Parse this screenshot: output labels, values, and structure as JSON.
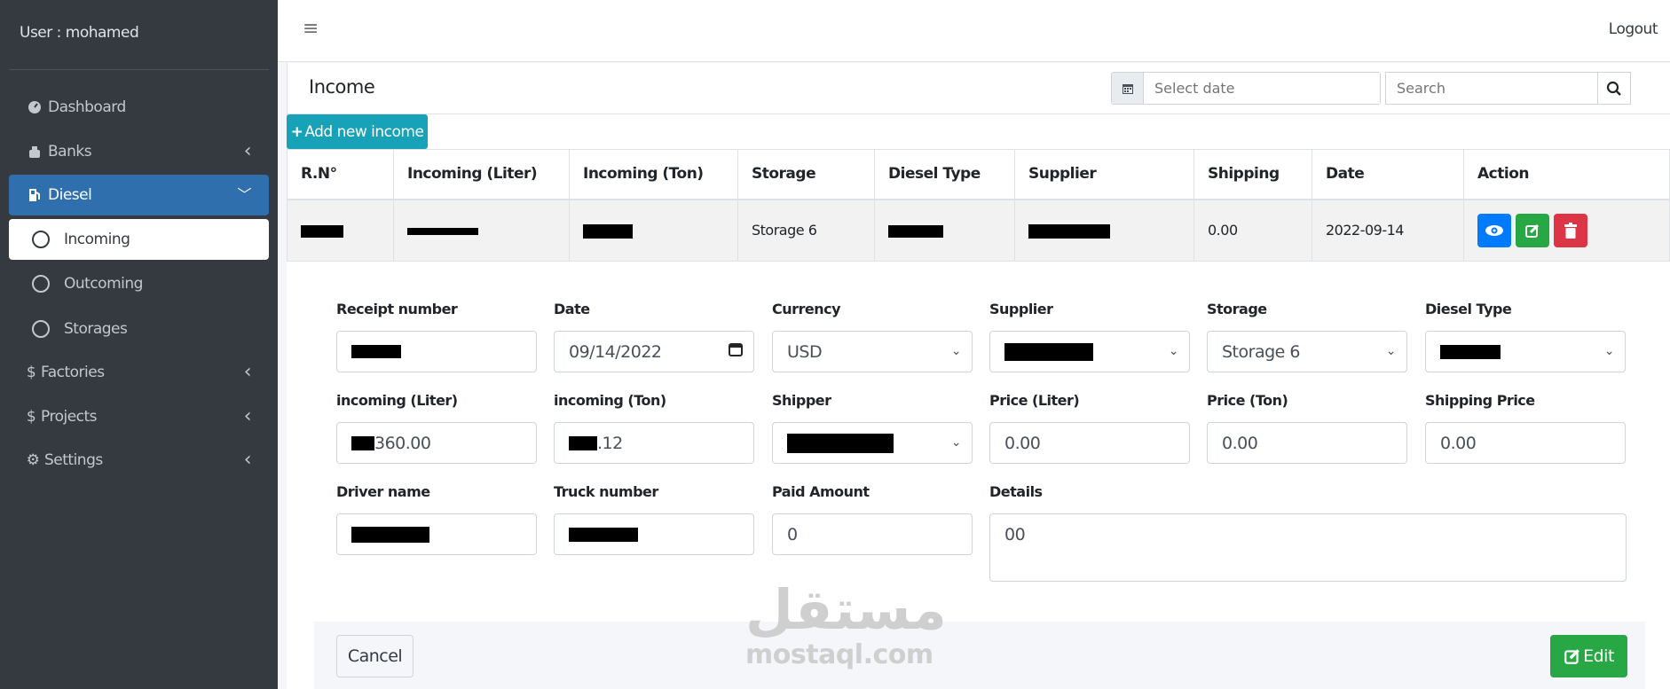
{
  "sidebar": {
    "user": "User : mohamed",
    "items": [
      {
        "label": "Dashboard"
      },
      {
        "label": "Banks"
      },
      {
        "label": "Diesel"
      },
      {
        "label": "Incoming"
      },
      {
        "label": "Outcoming"
      },
      {
        "label": "Storages"
      },
      {
        "label": "Factories"
      },
      {
        "label": "Projects"
      },
      {
        "label": "Settings"
      }
    ]
  },
  "topbar": {
    "logout": "Logout"
  },
  "card": {
    "title": "Income",
    "date_placeholder": "Select date",
    "search_placeholder": "Search",
    "add_button": "Add new income"
  },
  "table": {
    "headers": [
      "R.N°",
      "Incoming (Liter)",
      "Incoming (Ton)",
      "Storage",
      "Diesel Type",
      "Supplier",
      "Shipping",
      "Date",
      "Action"
    ],
    "row": {
      "storage": "Storage 6",
      "shipping": "0.00",
      "date": "2022-09-14"
    }
  },
  "form": {
    "labels": {
      "receipt": "Receipt number",
      "date": "Date",
      "currency": "Currency",
      "supplier": "Supplier",
      "storage": "Storage",
      "diesel_type": "Diesel Type",
      "liter": "incoming (Liter)",
      "ton": "incoming (Ton)",
      "shipper": "Shipper",
      "price_liter": "Price (Liter)",
      "price_ton": "Price (Ton)",
      "shipping_price": "Shipping Price",
      "driver": "Driver name",
      "truck": "Truck number",
      "paid": "Paid Amount",
      "details": "Details"
    },
    "values": {
      "date": "09/14/2022",
      "currency": "USD",
      "storage": "Storage 6",
      "liter": "360.00",
      "ton": ".12",
      "price_liter": "0.00",
      "price_ton": "0.00",
      "shipping_price": "0.00",
      "paid": "0",
      "details": "00"
    },
    "cancel": "Cancel",
    "edit": "Edit"
  },
  "watermark": {
    "arabic": "مستقل",
    "latin": "mostaql.com"
  },
  "colors": {
    "sidebar": "#343a40",
    "active": "#2f6fad",
    "teal": "#17a2b8",
    "green": "#28a745",
    "blue": "#007bff",
    "red": "#dc3545"
  }
}
